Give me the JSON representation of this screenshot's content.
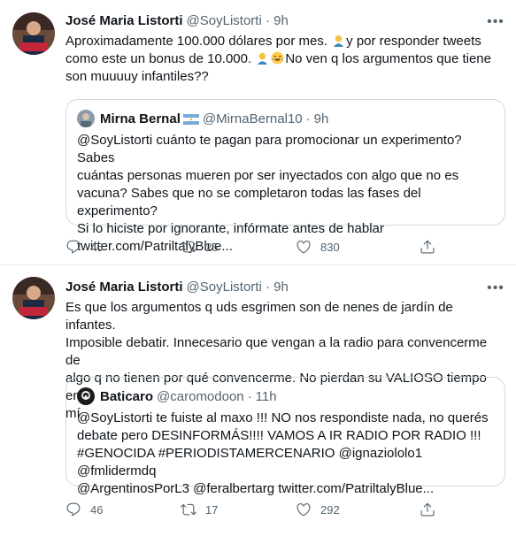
{
  "tweets": [
    {
      "author": {
        "name": "José Maria Listorti",
        "handle": "@SoyListorti",
        "time": "9h"
      },
      "text_lines": [
        [
          "Aproximadamente 100.000 dólares por mes. ",
          "y por responder tweets"
        ],
        [
          "como este un bonus de 10.000. ",
          "No ven q los argumentos que tiene"
        ],
        [
          "son muuuuy infantiles??"
        ]
      ],
      "quote": {
        "author": {
          "name": "Mirna Bernal",
          "handle": "@MirnaBernal10",
          "time": "9h"
        },
        "text_lines": [
          "@SoyListorti cuánto te pagan para promocionar un experimento? Sabes",
          "cuántas personas mueren por ser inyectados con algo que no es",
          "vacuna? Sabes que no se completaron todas las fases del experimento?",
          "Si lo hiciste por ignorante, infórmate antes de hablar",
          "twitter.com/PatriltalyBlue..."
        ]
      },
      "stats": {
        "replies": "46",
        "retweets": "25",
        "likes": "830"
      }
    },
    {
      "author": {
        "name": "José Maria Listorti",
        "handle": "@SoyListorti",
        "time": "9h"
      },
      "text_lines": [
        "Es que los argumentos q uds esgrimen son de nenes de jardín de infantes.",
        "Imposible debatir. Innecesario que vengan a la radio para convencerme de",
        "algo q no tienen por qué convencerme. No pierdan su VALIOSO tiempo en",
        "mí"
      ],
      "quote": {
        "author": {
          "name": "Baticaro",
          "handle": "@caromodoon",
          "time": "11h"
        },
        "text_lines": [
          "@SoyListorti te fuiste al maxo !!! NO nos respondiste nada, no querés",
          "debate pero DESINFORMÁS!!!! VAMOS A IR RADIO POR RADIO !!!",
          "#GENOCIDA #PERIODISTAMERCENARIO @ignaziololo1 @fmlidermdq",
          "@ArgentinosPorL3 @feralbertarg twitter.com/PatriltalyBlue..."
        ]
      },
      "stats": {
        "replies": "46",
        "retweets": "17",
        "likes": "292"
      }
    }
  ],
  "separator": "·",
  "icons": {
    "more": "more-horizontal-icon",
    "reply": "reply-icon",
    "retweet": "retweet-icon",
    "like": "heart-icon",
    "share": "share-icon",
    "emoji_1": "man-emoji",
    "emoji_2": "laughing-emoji",
    "flag": "argentina-flag"
  },
  "colors": {
    "text": "#0f1419",
    "secondary": "#536471",
    "border": "#cfd9de",
    "divider": "#e6ecf0"
  }
}
